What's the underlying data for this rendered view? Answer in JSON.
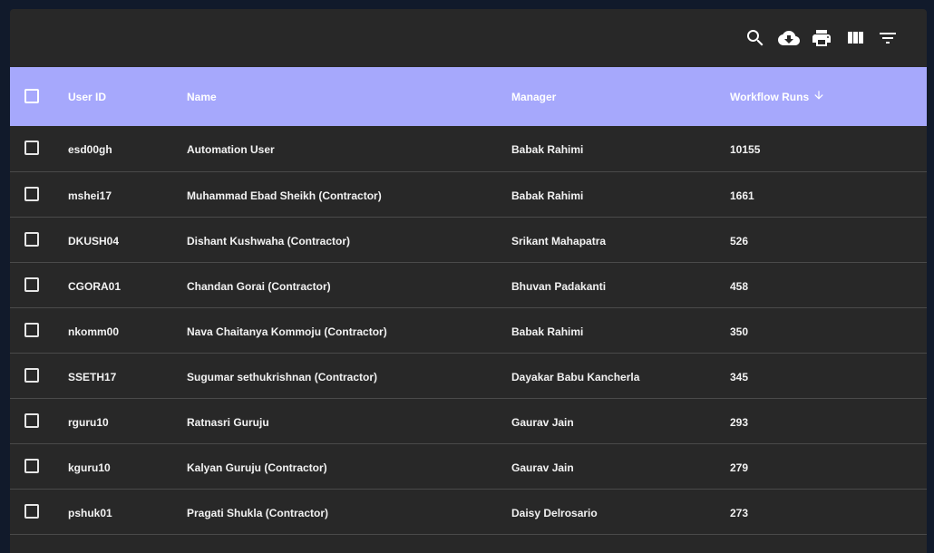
{
  "toolbar": {
    "icons": [
      "search-icon",
      "cloud-download-icon",
      "print-icon",
      "view-column-icon",
      "filter-list-icon"
    ]
  },
  "table": {
    "columns": {
      "user_id": "User ID",
      "name": "Name",
      "manager": "Manager",
      "workflow_runs": "Workflow Runs"
    },
    "sort": {
      "column": "workflow_runs",
      "direction": "descending"
    },
    "rows": [
      {
        "user_id": "esd00gh",
        "name": "Automation User",
        "manager": "Babak Rahimi",
        "workflow_runs": "10155"
      },
      {
        "user_id": "mshei17",
        "name": "Muhammad Ebad Sheikh (Contractor)",
        "manager": "Babak Rahimi",
        "workflow_runs": "1661"
      },
      {
        "user_id": "DKUSH04",
        "name": "Dishant Kushwaha (Contractor)",
        "manager": "Srikant Mahapatra",
        "workflow_runs": "526"
      },
      {
        "user_id": "CGORA01",
        "name": "Chandan Gorai (Contractor)",
        "manager": "Bhuvan Padakanti",
        "workflow_runs": "458"
      },
      {
        "user_id": "nkomm00",
        "name": "Nava Chaitanya Kommoju (Contractor)",
        "manager": "Babak Rahimi",
        "workflow_runs": "350"
      },
      {
        "user_id": "SSETH17",
        "name": "Sugumar sethukrishnan (Contractor)",
        "manager": "Dayakar Babu Kancherla",
        "workflow_runs": "345"
      },
      {
        "user_id": "rguru10",
        "name": "Ratnasri Guruju",
        "manager": "Gaurav Jain",
        "workflow_runs": "293"
      },
      {
        "user_id": "kguru10",
        "name": "Kalyan Guruju (Contractor)",
        "manager": "Gaurav Jain",
        "workflow_runs": "279"
      },
      {
        "user_id": "pshuk01",
        "name": "Pragati Shukla (Contractor)",
        "manager": "Daisy Delrosario",
        "workflow_runs": "273"
      }
    ]
  },
  "colors": {
    "header_bg": "#a6a8fc",
    "panel_bg": "#282828",
    "page_bg": "#111a2b",
    "text": "#ffffff"
  }
}
